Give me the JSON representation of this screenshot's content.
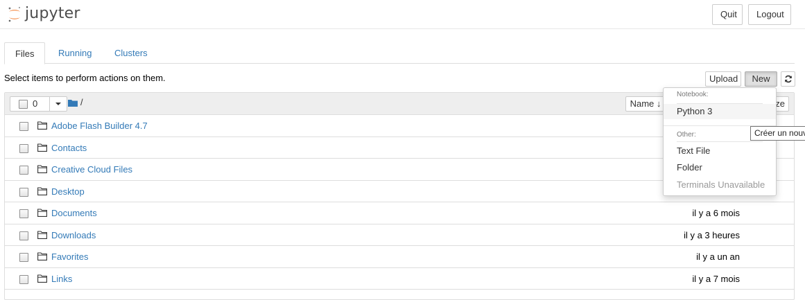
{
  "header": {
    "logo_text": "jupyter",
    "quit_label": "Quit",
    "logout_label": "Logout"
  },
  "tabs": [
    {
      "label": "Files",
      "active": true
    },
    {
      "label": "Running",
      "active": false
    },
    {
      "label": "Clusters",
      "active": false
    }
  ],
  "toolbar": {
    "hint": "Select items to perform actions on them.",
    "upload_label": "Upload",
    "new_label": "New",
    "refresh_icon": "refresh-icon"
  },
  "list": {
    "selected_count": "0",
    "path": "/",
    "sort_name_label": "Name",
    "sort_size_label": "ze",
    "items": [
      {
        "name": "Adobe Flash Builder 4.7",
        "modified": ""
      },
      {
        "name": "Contacts",
        "modified": ""
      },
      {
        "name": "Creative Cloud Files",
        "modified": ""
      },
      {
        "name": "Desktop",
        "modified": ""
      },
      {
        "name": "Documents",
        "modified": "il y a 6 mois"
      },
      {
        "name": "Downloads",
        "modified": "il y a 3 heures"
      },
      {
        "name": "Favorites",
        "modified": "il y a un an"
      },
      {
        "name": "Links",
        "modified": "il y a 7 mois"
      }
    ]
  },
  "new_menu": {
    "notebook_header": "Notebook:",
    "python3": "Python 3",
    "other_header": "Other:",
    "text_file": "Text File",
    "folder": "Folder",
    "terminals": "Terminals Unavailable"
  },
  "tooltip": "Créer un nouv",
  "colors": {
    "link": "#337ab7",
    "jupyter_orange": "#f37726",
    "header_bg": "#eeeeee"
  }
}
